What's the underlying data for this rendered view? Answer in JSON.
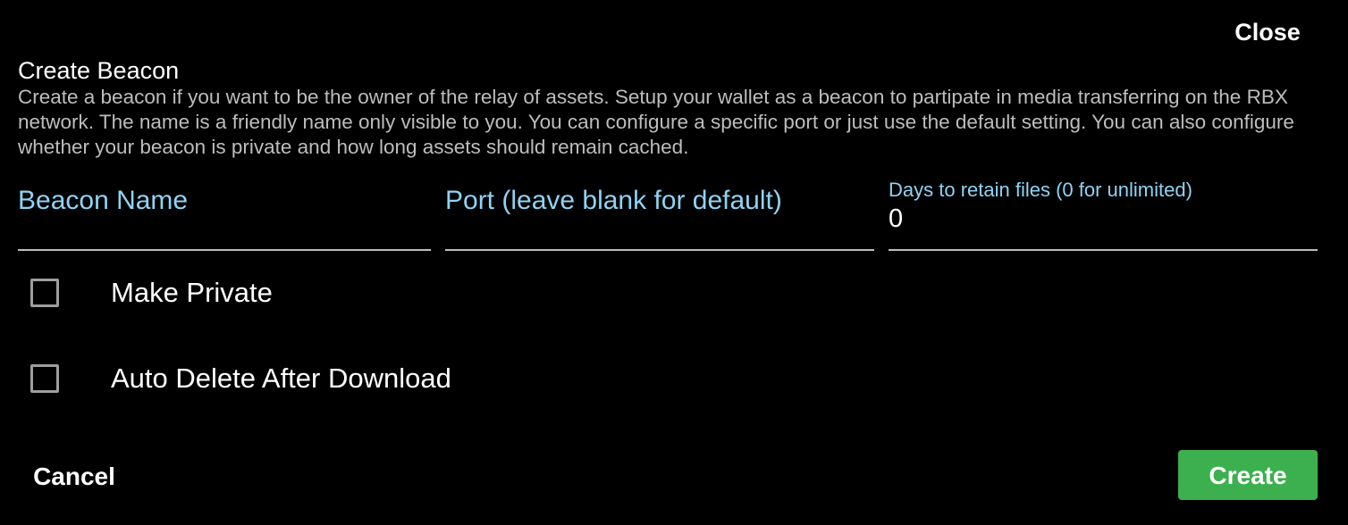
{
  "dialog": {
    "close_label": "Close",
    "title": "Create Beacon",
    "description": "Create a beacon if you want to be the owner of the relay of assets. Setup your wallet as a beacon to partipate in media transferring on the RBX network. The name is a friendly name only visible to you. You can configure a specific port or just use the default setting. You can also configure whether your beacon is private and how long assets should remain cached."
  },
  "fields": {
    "beacon_name": {
      "label": "Beacon Name",
      "value": ""
    },
    "port": {
      "label": "Port (leave blank for default)",
      "value": ""
    },
    "days_to_retain": {
      "label": "Days to retain files (0 for unlimited)",
      "value": "0"
    }
  },
  "checkboxes": [
    {
      "label": "Make Private",
      "checked": false
    },
    {
      "label": "Auto Delete After Download",
      "checked": false
    }
  ],
  "actions": {
    "cancel_label": "Cancel",
    "create_label": "Create"
  },
  "colors": {
    "background": "#000000",
    "label_accent": "#8fd3f4",
    "create_button": "#3cb04e",
    "description_text": "#bdbdbd"
  }
}
